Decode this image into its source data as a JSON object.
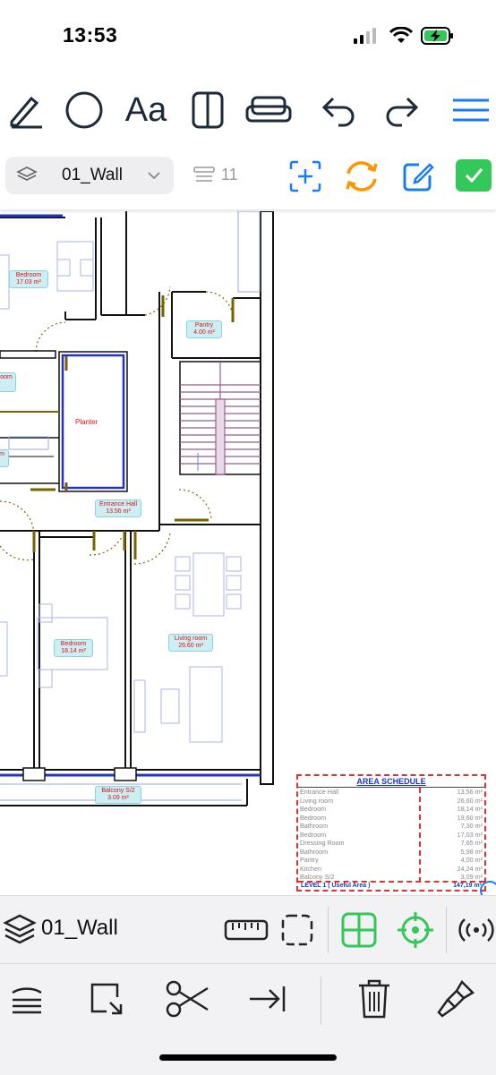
{
  "status_bar": {
    "time": "13:53"
  },
  "top_toolbar": {
    "tools": [
      "pencil-icon",
      "circle-icon",
      "text-icon",
      "door-icon",
      "sofa-icon",
      "undo-icon",
      "redo-icon",
      "menu-icon"
    ],
    "text_tool_label": "Aa"
  },
  "layer_bar": {
    "layer_name": "01_Wall",
    "object_count": "11",
    "actions": [
      "add-selection-icon",
      "sync-icon",
      "edit-icon",
      "confirm-icon"
    ],
    "colors": {
      "accent_blue": "#1a7cf5",
      "sync_orange": "#ff9500",
      "confirm_green": "#34c759"
    }
  },
  "plan": {
    "rooms": [
      {
        "name": "Bedroom",
        "area": "17.03 m²"
      },
      {
        "name": "Pantry",
        "area": "4.00 m²"
      },
      {
        "name": "oom",
        "area": ""
      },
      {
        "name": "Planter",
        "area": ""
      },
      {
        "name": "m",
        "area": ""
      },
      {
        "name": "Entrance Hall",
        "area": "13.56 m²"
      },
      {
        "name": "Bedroom",
        "area": "18.14 m²"
      },
      {
        "name": "Living room",
        "area": "26.60 m²"
      },
      {
        "name": "Balcony S/2",
        "area": "3.09 m²"
      }
    ]
  },
  "area_schedule": {
    "title": "AREA SCHEDULE",
    "rows": [
      {
        "name": "Entrance Hall",
        "value": "13,56 m²"
      },
      {
        "name": "Living room",
        "value": "26,60 m²"
      },
      {
        "name": "Bedroom",
        "value": "18,14 m²"
      },
      {
        "name": "Bedroom",
        "value": "19,60 m²"
      },
      {
        "name": "Bathroom",
        "value": "7,30 m²"
      },
      {
        "name": "Bedroom",
        "value": "17,03 m²"
      },
      {
        "name": "Dressing Room",
        "value": "7,65 m²"
      },
      {
        "name": "Bathroom",
        "value": "5,98 m²"
      },
      {
        "name": "Pantry",
        "value": "4,00 m²"
      },
      {
        "name": "Kitchen",
        "value": "24,24 m²"
      },
      {
        "name": "Balcony S/2",
        "value": "3,09 m²"
      }
    ],
    "total_label": "LEVEL 1 ( Useful Area )",
    "total_value": "147,19 m²"
  },
  "bottom_bar": {
    "layer_name": "01_Wall",
    "tools": [
      "layers-icon",
      "ruler-icon",
      "selection-box-icon",
      "grid-snap-icon",
      "crosshair-icon",
      "signal-icon"
    ],
    "active_color": "#34c759"
  },
  "edit_bar": {
    "tools": [
      "stack-icon",
      "resize-icon",
      "scissors-icon",
      "extend-icon",
      "trash-icon",
      "paint-brush-icon"
    ]
  }
}
